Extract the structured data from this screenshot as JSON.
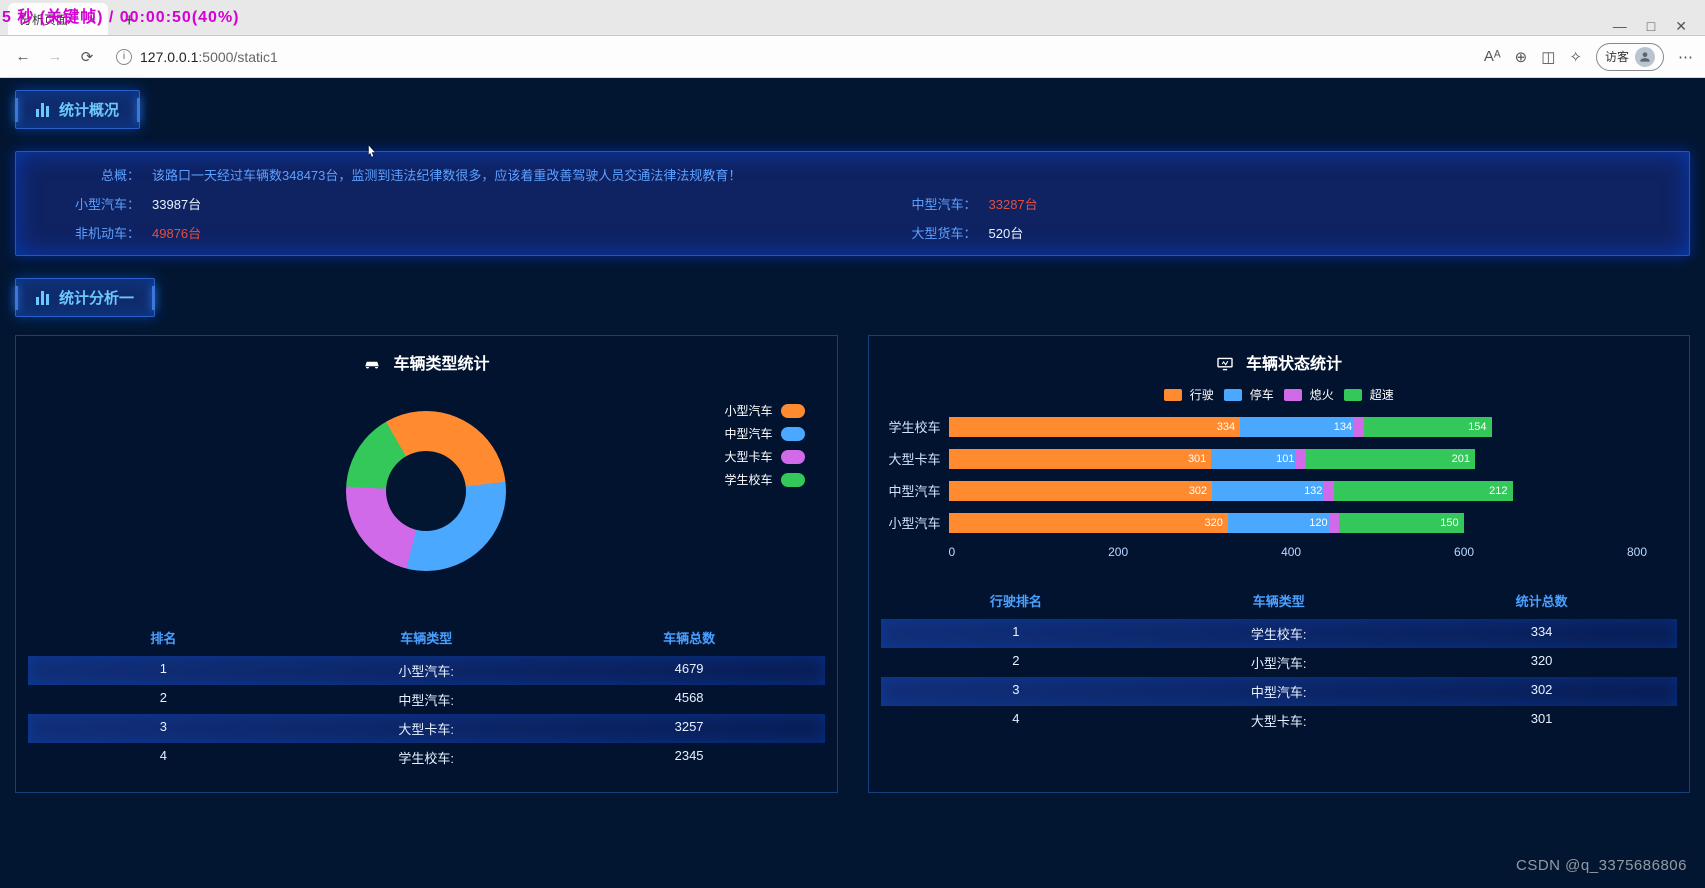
{
  "browser": {
    "tab_title": "分析页面",
    "tab_close": "×",
    "new_tab": "+",
    "window_min": "—",
    "window_max": "□",
    "window_close": "✕",
    "back": "←",
    "forward": "→",
    "reload": "⟳",
    "info_i": "i",
    "url_host": "127.0.0.1",
    "url_port_path": ":5000/static1",
    "tool_aA": "Aᴬ",
    "tool_zoom": "⊕",
    "tool_split": "◫",
    "tool_star": "✧",
    "guest_label": "访客",
    "more": "⋯"
  },
  "timer_overlay": "  5 秒 (关键帧)  / 00:00:50(40%)",
  "sections": {
    "overview_title": "统计概况",
    "analysis_title": "统计分析一"
  },
  "overview": {
    "row1_label": "总概：",
    "row1_val": "该路口一天经过车辆数348473台，监测到违法纪律数很多，应该着重改善驾驶人员交通法律法规教育！",
    "small_label": "小型汽车：",
    "small_val": "33987台",
    "medium_label": "中型汽车：",
    "medium_val": "33287台",
    "nonmotor_label": "非机动车：",
    "nonmotor_val": "49876台",
    "truck_label": "大型货车：",
    "truck_val": "520台"
  },
  "panels": {
    "donut_title": "车辆类型统计",
    "bar_title": "车辆状态统计"
  },
  "donut_legend": {
    "a": "小型汽车",
    "b": "中型汽车",
    "c": "大型卡车",
    "d": "学生校车"
  },
  "bar_legend": {
    "s1": "行驶",
    "s2": "停车",
    "s3": "熄火",
    "s4": "超速"
  },
  "table_left": {
    "h1": "排名",
    "h2": "车辆类型",
    "h3": "车辆总数",
    "rows": [
      {
        "r": "1",
        "t": "小型汽车:",
        "n": "4679"
      },
      {
        "r": "2",
        "t": "中型汽车:",
        "n": "4568"
      },
      {
        "r": "3",
        "t": "大型卡车:",
        "n": "3257"
      },
      {
        "r": "4",
        "t": "学生校车:",
        "n": "2345"
      }
    ]
  },
  "table_right": {
    "h1": "行驶排名",
    "h2": "车辆类型",
    "h3": "统计总数",
    "rows": [
      {
        "r": "1",
        "t": "学生校车:",
        "n": "334"
      },
      {
        "r": "2",
        "t": "小型汽车:",
        "n": "320"
      },
      {
        "r": "3",
        "t": "中型汽车:",
        "n": "302"
      },
      {
        "r": "4",
        "t": "大型卡车:",
        "n": "301"
      }
    ]
  },
  "watermark": "CSDN @q_3375686806",
  "chart_data": [
    {
      "type": "pie",
      "title": "车辆类型统计",
      "series": [
        {
          "name": "小型汽车",
          "value": 4679,
          "color": "#ff8a30"
        },
        {
          "name": "中型汽车",
          "value": 4568,
          "color": "#4aa8ff"
        },
        {
          "name": "大型卡车",
          "value": 3257,
          "color": "#d06ae8"
        },
        {
          "name": "学生校车",
          "value": 2345,
          "color": "#34c759"
        }
      ]
    },
    {
      "type": "bar",
      "title": "车辆状态统计",
      "orientation": "horizontal",
      "stacked": true,
      "xlabel": "",
      "ylabel": "",
      "xlim": [
        0,
        800
      ],
      "x_ticks": [
        0,
        200,
        400,
        600,
        800
      ],
      "categories": [
        "学生校车",
        "大型卡车",
        "中型汽车",
        "小型汽车"
      ],
      "series": [
        {
          "name": "行驶",
          "color": "#ff8a30",
          "values": [
            334,
            301,
            302,
            320
          ]
        },
        {
          "name": "停车",
          "color": "#4aa8ff",
          "values": [
            134,
            101,
            132,
            120
          ]
        },
        {
          "name": "熄火",
          "color": "#d06ae8",
          "values": [
            12,
            12,
            12,
            12
          ]
        },
        {
          "name": "超速",
          "color": "#34c759",
          "values": [
            154,
            201,
            212,
            150
          ]
        }
      ],
      "legend_position": "top"
    }
  ]
}
